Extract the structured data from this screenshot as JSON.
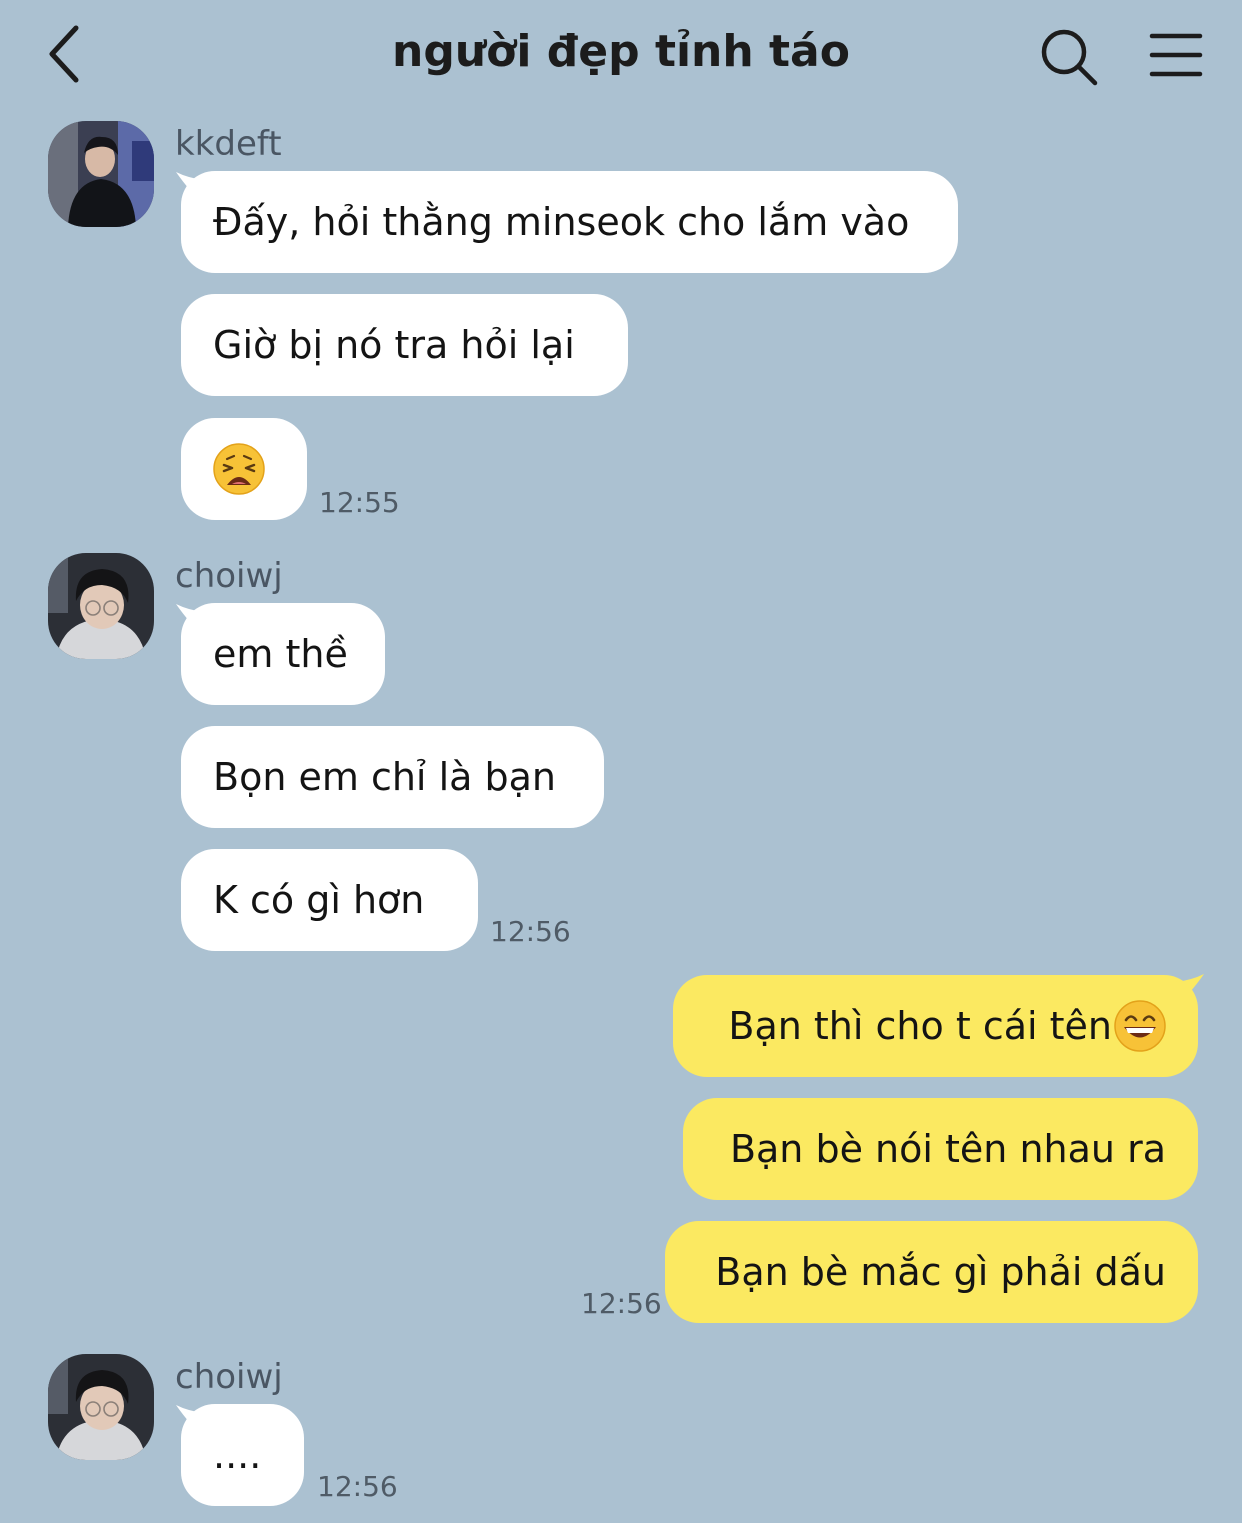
{
  "header": {
    "title": "người đẹp tỉnh táo",
    "back_icon": "chevron-left-icon",
    "search_icon": "search-icon",
    "menu_icon": "hamburger-menu-icon"
  },
  "colors": {
    "background": "#abc1d1",
    "incoming_bubble": "#ffffff",
    "outgoing_bubble": "#fbe961"
  },
  "groups": [
    {
      "sender": "kkdeft",
      "messages": [
        "Đấy, hỏi thằng minseok cho lắm vào",
        "Giờ bị nó tra hỏi lại",
        "😩"
      ],
      "time": "12:55"
    },
    {
      "sender": "choiwj",
      "messages": [
        "em thề",
        "Bọn em chỉ là bạn",
        "K có gì hơn"
      ],
      "time": "12:56"
    },
    {
      "sender": "me",
      "messages": [
        "Bạn thì cho t cái tên",
        "Bạn bè nói tên nhau ra",
        "Bạn bè mắc gì phải dấu"
      ],
      "emoji_after_first": "😄",
      "time": "12:56"
    },
    {
      "sender": "choiwj",
      "messages": [
        "...."
      ],
      "time": "12:56"
    }
  ]
}
